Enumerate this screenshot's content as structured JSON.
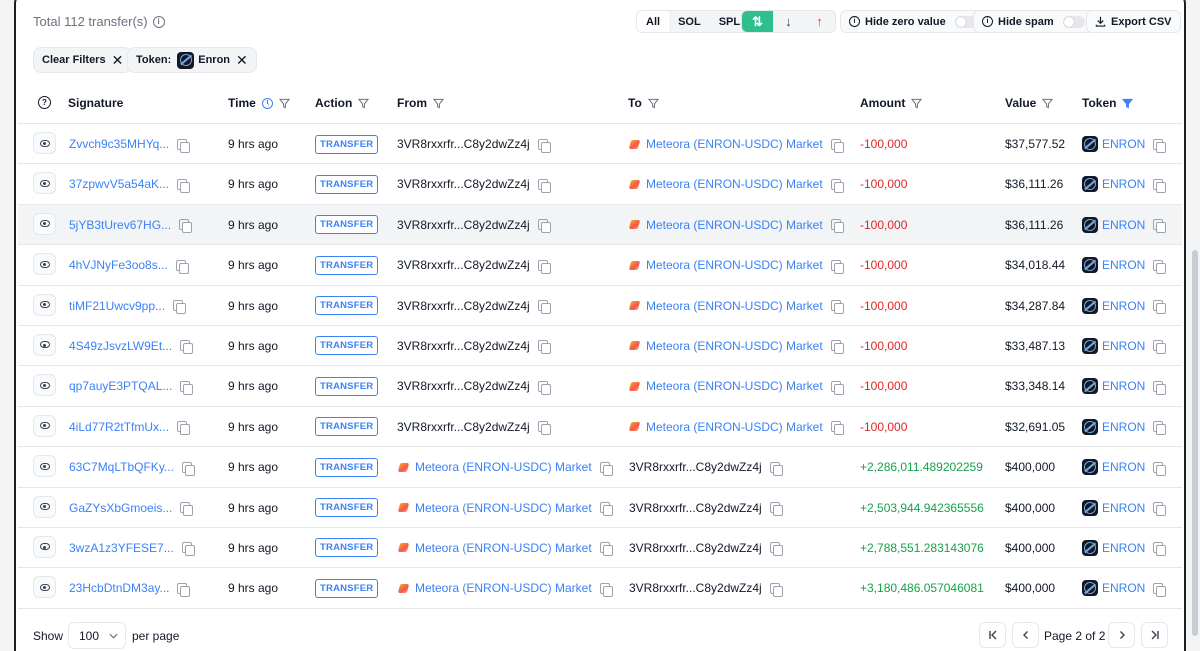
{
  "header": {
    "total": "Total 112 transfer(s)",
    "filters": [
      "All",
      "SOL",
      "SPL"
    ],
    "directions": [
      {
        "icon": "swap-vertical-icon",
        "glyph": "⇅"
      },
      {
        "icon": "arrow-down-icon",
        "glyph": "↓"
      },
      {
        "icon": "arrow-up-icon",
        "glyph": "↑"
      }
    ],
    "hide_zero": "Hide zero value",
    "hide_spam": "Hide spam",
    "export": "Export CSV"
  },
  "chips": {
    "clear": "Clear Filters",
    "token_label": "Token:",
    "token_value": "Enron"
  },
  "columns": {
    "signature": "Signature",
    "time": "Time",
    "action": "Action",
    "from": "From",
    "to": "To",
    "amount": "Amount",
    "value": "Value",
    "token": "Token"
  },
  "rows": [
    {
      "sig": "Zvvch9c35MHYq...",
      "time": "9 hrs ago",
      "action": "TRANSFER",
      "from": "3VR8rxxrfr...C8y2dwZz4j",
      "from_market": false,
      "to": "Meteora (ENRON-USDC) Market",
      "to_market": true,
      "amount": "-100,000",
      "sign": "neg",
      "value": "$37,577.52",
      "token": "ENRON"
    },
    {
      "sig": "37zpwvV5a54aK...",
      "time": "9 hrs ago",
      "action": "TRANSFER",
      "from": "3VR8rxxrfr...C8y2dwZz4j",
      "from_market": false,
      "to": "Meteora (ENRON-USDC) Market",
      "to_market": true,
      "amount": "-100,000",
      "sign": "neg",
      "value": "$36,111.26",
      "token": "ENRON"
    },
    {
      "sig": "5jYB3tUrev67HG...",
      "time": "9 hrs ago",
      "action": "TRANSFER",
      "from": "3VR8rxxrfr...C8y2dwZz4j",
      "from_market": false,
      "to": "Meteora (ENRON-USDC) Market",
      "to_market": true,
      "amount": "-100,000",
      "sign": "neg",
      "value": "$36,111.26",
      "token": "ENRON"
    },
    {
      "sig": "4hVJNyFe3oo8s...",
      "time": "9 hrs ago",
      "action": "TRANSFER",
      "from": "3VR8rxxrfr...C8y2dwZz4j",
      "from_market": false,
      "to": "Meteora (ENRON-USDC) Market",
      "to_market": true,
      "amount": "-100,000",
      "sign": "neg",
      "value": "$34,018.44",
      "token": "ENRON"
    },
    {
      "sig": "tiMF21Uwcv9pp...",
      "time": "9 hrs ago",
      "action": "TRANSFER",
      "from": "3VR8rxxrfr...C8y2dwZz4j",
      "from_market": false,
      "to": "Meteora (ENRON-USDC) Market",
      "to_market": true,
      "amount": "-100,000",
      "sign": "neg",
      "value": "$34,287.84",
      "token": "ENRON"
    },
    {
      "sig": "4S49zJsvzLW9Et...",
      "time": "9 hrs ago",
      "action": "TRANSFER",
      "from": "3VR8rxxrfr...C8y2dwZz4j",
      "from_market": false,
      "to": "Meteora (ENRON-USDC) Market",
      "to_market": true,
      "amount": "-100,000",
      "sign": "neg",
      "value": "$33,487.13",
      "token": "ENRON"
    },
    {
      "sig": "qp7auyE3PTQAL...",
      "time": "9 hrs ago",
      "action": "TRANSFER",
      "from": "3VR8rxxrfr...C8y2dwZz4j",
      "from_market": false,
      "to": "Meteora (ENRON-USDC) Market",
      "to_market": true,
      "amount": "-100,000",
      "sign": "neg",
      "value": "$33,348.14",
      "token": "ENRON"
    },
    {
      "sig": "4iLd77R2tTfmUx...",
      "time": "9 hrs ago",
      "action": "TRANSFER",
      "from": "3VR8rxxrfr...C8y2dwZz4j",
      "from_market": false,
      "to": "Meteora (ENRON-USDC) Market",
      "to_market": true,
      "amount": "-100,000",
      "sign": "neg",
      "value": "$32,691.05",
      "token": "ENRON"
    },
    {
      "sig": "63C7MqLTbQFKy...",
      "time": "9 hrs ago",
      "action": "TRANSFER",
      "from": "Meteora (ENRON-USDC) Market",
      "from_market": true,
      "to": "3VR8rxxrfr...C8y2dwZz4j",
      "to_market": false,
      "amount": "+2,286,011.489202259",
      "sign": "pos",
      "value": "$400,000",
      "token": "ENRON"
    },
    {
      "sig": "GaZYsXbGmoeis...",
      "time": "9 hrs ago",
      "action": "TRANSFER",
      "from": "Meteora (ENRON-USDC) Market",
      "from_market": true,
      "to": "3VR8rxxrfr...C8y2dwZz4j",
      "to_market": false,
      "amount": "+2,503,944.942365556",
      "sign": "pos",
      "value": "$400,000",
      "token": "ENRON"
    },
    {
      "sig": "3wzA1z3YFESE7...",
      "time": "9 hrs ago",
      "action": "TRANSFER",
      "from": "Meteora (ENRON-USDC) Market",
      "from_market": true,
      "to": "3VR8rxxrfr...C8y2dwZz4j",
      "to_market": false,
      "amount": "+2,788,551.283143076",
      "sign": "pos",
      "value": "$400,000",
      "token": "ENRON"
    },
    {
      "sig": "23HcbDtnDM3ay...",
      "time": "9 hrs ago",
      "action": "TRANSFER",
      "from": "Meteora (ENRON-USDC) Market",
      "from_market": true,
      "to": "3VR8rxxrfr...C8y2dwZz4j",
      "to_market": false,
      "amount": "+3,180,486.057046081",
      "sign": "pos",
      "value": "$400,000",
      "token": "ENRON"
    }
  ],
  "footer": {
    "show": "Show",
    "per_page_value": "100",
    "per_page": "per page",
    "page_info": "Page 2 of 2"
  },
  "colors": {
    "link": "#3b82f6",
    "negative": "#dc2626",
    "positive": "#16a34a",
    "accent": "#2fbf8c"
  }
}
